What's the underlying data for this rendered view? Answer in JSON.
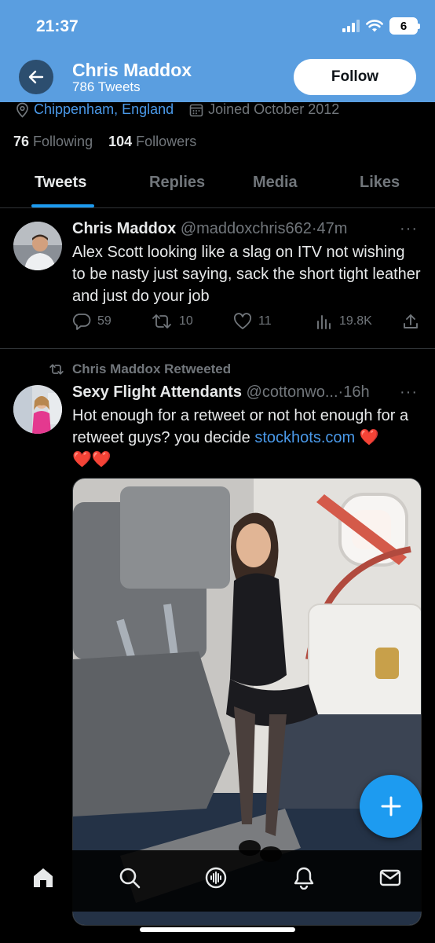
{
  "status_bar": {
    "time": "21:37",
    "battery": "6"
  },
  "header": {
    "name": "Chris Maddox",
    "tweet_count": "786 Tweets",
    "follow_label": "Follow"
  },
  "profile": {
    "location": "Chippenham, England",
    "joined": "Joined October 2012",
    "following_count": "76",
    "following_label": "Following",
    "followers_count": "104",
    "followers_label": "Followers"
  },
  "tabs": [
    {
      "label": "Tweets",
      "active": true
    },
    {
      "label": "Replies",
      "active": false
    },
    {
      "label": "Media",
      "active": false
    },
    {
      "label": "Likes",
      "active": false
    }
  ],
  "tweets": [
    {
      "name": "Chris Maddox",
      "handle": "@maddoxchris662",
      "time": "47m",
      "text": "Alex Scott looking like a slag on ITV not wishing to be nasty just saying, sack the short tight leather and just do your job",
      "replies": "59",
      "retweets": "10",
      "likes": "11",
      "views": "19.8K"
    },
    {
      "retweeted_by": "Chris Maddox Retweeted",
      "name": "Sexy Flight Attendants",
      "handle": "@cottonwo...",
      "time": "16h",
      "text": "Hot enough for a retweet or not hot enough for a retweet  guys? you decide",
      "link": "stockhots.com",
      "hearts": "❤️",
      "hearts_line2": "❤️❤️"
    }
  ],
  "colors": {
    "header_bg": "#5a9ee0",
    "accent": "#1d9bf0",
    "link": "#4a99e9"
  },
  "icons": [
    "back-arrow-icon",
    "location-pin-icon",
    "calendar-icon",
    "more-icon",
    "reply-icon",
    "retweet-icon",
    "like-icon",
    "views-icon",
    "share-icon",
    "plus-icon",
    "home-icon",
    "search-icon",
    "spaces-icon",
    "notifications-icon",
    "messages-icon"
  ]
}
